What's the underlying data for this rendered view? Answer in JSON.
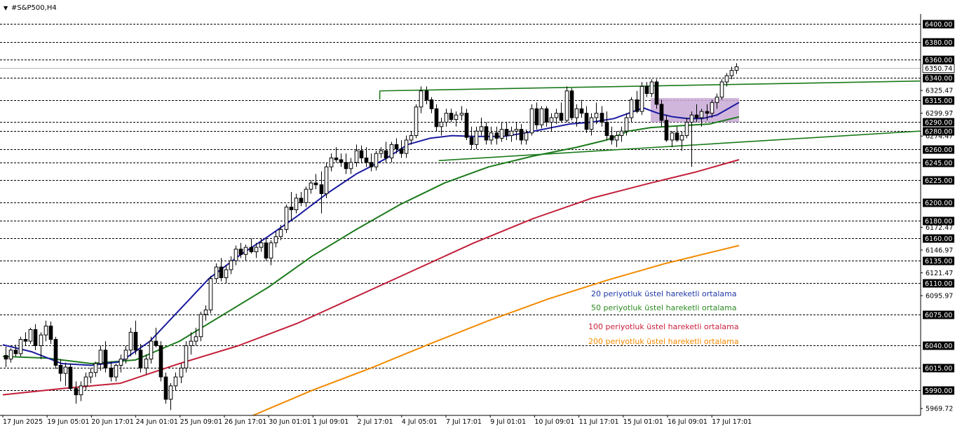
{
  "window": {
    "title": "#S&P500,H4",
    "menu_icon": "triangle-down-icon"
  },
  "chart_data": {
    "type": "candlestick",
    "symbol": "#S&P500",
    "timeframe": "H4",
    "ylim": [
      5962,
      6411
    ],
    "grid": "horizontal dashed at price levels",
    "price_levels": [
      6400.0,
      6380.0,
      6360.0,
      6340.0,
      6315.0,
      6290.0,
      6280.0,
      6260.0,
      6245.0,
      6225.0,
      6200.0,
      6180.0,
      6160.0,
      6135.0,
      6110.0,
      6075.0,
      6040.0,
      6015.0,
      5990.0
    ],
    "price_labels": [
      "6400.00",
      "6380.00",
      "6360.00",
      "6340.00",
      "6315.00",
      "6290.00",
      "6280.00",
      "6260.00",
      "6245.00",
      "6225.00",
      "6200.00",
      "6180.00",
      "6160.00",
      "6135.00",
      "6110.00",
      "6075.00",
      "6040.00",
      "6015.00",
      "5990.00"
    ],
    "y_tick_labels": [
      {
        "value": 6325.47,
        "label": "6325.47"
      },
      {
        "value": 6299.97,
        "label": "6299.97"
      },
      {
        "value": 6274.47,
        "label": "6274.47"
      },
      {
        "value": 6172.47,
        "label": "6172.47"
      },
      {
        "value": 6146.97,
        "label": "6146.97"
      },
      {
        "value": 6121.47,
        "label": "6121.47"
      },
      {
        "value": 6095.97,
        "label": "6095.97"
      },
      {
        "value": 5969.72,
        "label": "5969.72"
      }
    ],
    "current_price": {
      "value": 6350.74,
      "label": "6350.74"
    },
    "x_labels": [
      "17 Jun 2025",
      "19 Jun 05:01",
      "20 Jun 17:01",
      "24 Jun 01:01",
      "25 Jun 09:01",
      "26 Jun 17:01",
      "30 Jun 01:01",
      "1 Jul 09:01",
      "2 Jul 17:01",
      "4 Jul 05:01",
      "7 Jul 17:01",
      "9 Jul 01:01",
      "10 Jul 09:01",
      "11 Jul 17:01",
      "15 Jul 01:01",
      "16 Jul 09:01",
      "17 Jul 17:01"
    ],
    "candles": [
      [
        6029,
        6039,
        6016,
        6025
      ],
      [
        6025,
        6037,
        6021,
        6035
      ],
      [
        6035,
        6041,
        6028,
        6031
      ],
      [
        6031,
        6050,
        6028,
        6047
      ],
      [
        6047,
        6055,
        6040,
        6045
      ],
      [
        6045,
        6060,
        6042,
        6058
      ],
      [
        6058,
        6064,
        6035,
        6040
      ],
      [
        6040,
        6055,
        6025,
        6052
      ],
      [
        6052,
        6068,
        6045,
        6062
      ],
      [
        6062,
        6067,
        6042,
        6047
      ],
      [
        6047,
        6050,
        6014,
        6018
      ],
      [
        6018,
        6025,
        6000,
        6009
      ],
      [
        6009,
        6021,
        5995,
        6016
      ],
      [
        6016,
        6020,
        5990,
        5992
      ],
      [
        5992,
        6000,
        5975,
        5985
      ],
      [
        5985,
        6000,
        5978,
        5995
      ],
      [
        5995,
        6010,
        5990,
        6005
      ],
      [
        6005,
        6015,
        5998,
        6010
      ],
      [
        6010,
        6022,
        6005,
        6020
      ],
      [
        6020,
        6040,
        6012,
        6035
      ],
      [
        6035,
        6045,
        6010,
        6015
      ],
      [
        6015,
        6022,
        6000,
        6005
      ],
      [
        6005,
        6020,
        6000,
        6018
      ],
      [
        6018,
        6030,
        6010,
        6025
      ],
      [
        6025,
        6040,
        6020,
        6035
      ],
      [
        6035,
        6060,
        6028,
        6055
      ],
      [
        6055,
        6068,
        6030,
        6035
      ],
      [
        6035,
        6042,
        6010,
        6015
      ],
      [
        6015,
        6030,
        6008,
        6025
      ],
      [
        6025,
        6050,
        6020,
        6045
      ],
      [
        6045,
        6060,
        6038,
        6040
      ],
      [
        6040,
        6045,
        6000,
        6005
      ],
      [
        6005,
        6010,
        5975,
        5980
      ],
      [
        5980,
        5998,
        5968,
        5995
      ],
      [
        5995,
        6010,
        5990,
        6005
      ],
      [
        6005,
        6020,
        5998,
        6015
      ],
      [
        6015,
        6045,
        6010,
        6040
      ],
      [
        6040,
        6055,
        6030,
        6045
      ],
      [
        6045,
        6060,
        6040,
        6050
      ],
      [
        6050,
        6078,
        6045,
        6075
      ],
      [
        6075,
        6085,
        6068,
        6080
      ],
      [
        6080,
        6118,
        6076,
        6115
      ],
      [
        6115,
        6132,
        6110,
        6128
      ],
      [
        6128,
        6138,
        6112,
        6116
      ],
      [
        6116,
        6130,
        6110,
        6125
      ],
      [
        6125,
        6140,
        6120,
        6135
      ],
      [
        6135,
        6152,
        6130,
        6148
      ],
      [
        6148,
        6155,
        6138,
        6142
      ],
      [
        6142,
        6153,
        6135,
        6150
      ],
      [
        6150,
        6160,
        6143,
        6145
      ],
      [
        6145,
        6155,
        6138,
        6150
      ],
      [
        6150,
        6160,
        6145,
        6155
      ],
      [
        6155,
        6160,
        6135,
        6138
      ],
      [
        6138,
        6158,
        6130,
        6155
      ],
      [
        6155,
        6168,
        6150,
        6162
      ],
      [
        6162,
        6175,
        6158,
        6170
      ],
      [
        6170,
        6198,
        6166,
        6195
      ],
      [
        6195,
        6212,
        6180,
        6192
      ],
      [
        6192,
        6210,
        6188,
        6205
      ],
      [
        6205,
        6212,
        6196,
        6200
      ],
      [
        6200,
        6218,
        6195,
        6215
      ],
      [
        6215,
        6225,
        6210,
        6222
      ],
      [
        6222,
        6232,
        6215,
        6220
      ],
      [
        6220,
        6235,
        6188,
        6210
      ],
      [
        6210,
        6245,
        6205,
        6240
      ],
      [
        6240,
        6255,
        6235,
        6250
      ],
      [
        6250,
        6262,
        6245,
        6248
      ],
      [
        6248,
        6255,
        6240,
        6245
      ],
      [
        6245,
        6255,
        6232,
        6238
      ],
      [
        6238,
        6250,
        6232,
        6245
      ],
      [
        6245,
        6265,
        6240,
        6258
      ],
      [
        6258,
        6264,
        6245,
        6250
      ],
      [
        6250,
        6262,
        6240,
        6245
      ],
      [
        6245,
        6255,
        6235,
        6240
      ],
      [
        6240,
        6258,
        6236,
        6255
      ],
      [
        6255,
        6262,
        6250,
        6258
      ],
      [
        6258,
        6268,
        6245,
        6250
      ],
      [
        6250,
        6268,
        6245,
        6265
      ],
      [
        6265,
        6272,
        6255,
        6260
      ],
      [
        6260,
        6270,
        6250,
        6255
      ],
      [
        6255,
        6275,
        6250,
        6270
      ],
      [
        6270,
        6280,
        6265,
        6275
      ],
      [
        6275,
        6310,
        6272,
        6307
      ],
      [
        6307,
        6330,
        6300,
        6325
      ],
      [
        6325,
        6330,
        6310,
        6315
      ],
      [
        6315,
        6318,
        6300,
        6305
      ],
      [
        6305,
        6310,
        6280,
        6285
      ],
      [
        6285,
        6295,
        6275,
        6290
      ],
      [
        6290,
        6305,
        6285,
        6300
      ],
      [
        6300,
        6305,
        6290,
        6293
      ],
      [
        6293,
        6302,
        6285,
        6298
      ],
      [
        6298,
        6308,
        6292,
        6300
      ],
      [
        6300,
        6305,
        6270,
        6273
      ],
      [
        6273,
        6285,
        6260,
        6265
      ],
      [
        6265,
        6285,
        6260,
        6280
      ],
      [
        6280,
        6295,
        6275,
        6285
      ],
      [
        6285,
        6290,
        6265,
        6270
      ],
      [
        6270,
        6285,
        6265,
        6278
      ],
      [
        6278,
        6285,
        6265,
        6272
      ],
      [
        6272,
        6290,
        6268,
        6282
      ],
      [
        6282,
        6290,
        6270,
        6275
      ],
      [
        6275,
        6285,
        6268,
        6280
      ],
      [
        6280,
        6290,
        6270,
        6282
      ],
      [
        6282,
        6288,
        6265,
        6270
      ],
      [
        6270,
        6282,
        6265,
        6278
      ],
      [
        6278,
        6310,
        6275,
        6305
      ],
      [
        6305,
        6312,
        6282,
        6287
      ],
      [
        6287,
        6308,
        6283,
        6305
      ],
      [
        6305,
        6308,
        6285,
        6290
      ],
      [
        6290,
        6300,
        6280,
        6295
      ],
      [
        6295,
        6305,
        6288,
        6300
      ],
      [
        6300,
        6312,
        6290,
        6292
      ],
      [
        6292,
        6330,
        6290,
        6325
      ],
      [
        6325,
        6328,
        6292,
        6295
      ],
      [
        6295,
        6310,
        6285,
        6305
      ],
      [
        6305,
        6315,
        6295,
        6300
      ],
      [
        6300,
        6308,
        6278,
        6282
      ],
      [
        6282,
        6300,
        6275,
        6295
      ],
      [
        6295,
        6312,
        6288,
        6300
      ],
      [
        6300,
        6308,
        6285,
        6290
      ],
      [
        6290,
        6302,
        6270,
        6275
      ],
      [
        6275,
        6285,
        6265,
        6270
      ],
      [
        6270,
        6280,
        6262,
        6275
      ],
      [
        6275,
        6285,
        6268,
        6280
      ],
      [
        6280,
        6300,
        6275,
        6295
      ],
      [
        6295,
        6318,
        6290,
        6315
      ],
      [
        6315,
        6325,
        6300,
        6302
      ],
      [
        6302,
        6335,
        6298,
        6330
      ],
      [
        6330,
        6335,
        6318,
        6322
      ],
      [
        6322,
        6338,
        6318,
        6335
      ],
      [
        6335,
        6338,
        6305,
        6310
      ],
      [
        6310,
        6315,
        6285,
        6292
      ],
      [
        6292,
        6298,
        6268,
        6270
      ],
      [
        6270,
        6280,
        6262,
        6278
      ],
      [
        6278,
        6285,
        6268,
        6270
      ],
      [
        6270,
        6280,
        6258,
        6275
      ],
      [
        6275,
        6295,
        6272,
        6290
      ],
      [
        6290,
        6302,
        6240,
        6298
      ],
      [
        6298,
        6310,
        6290,
        6295
      ],
      [
        6295,
        6305,
        6285,
        6302
      ],
      [
        6302,
        6310,
        6292,
        6300
      ],
      [
        6300,
        6315,
        6295,
        6312
      ],
      [
        6312,
        6322,
        6305,
        6318
      ],
      [
        6318,
        6338,
        6315,
        6335
      ],
      [
        6335,
        6345,
        6330,
        6342
      ],
      [
        6342,
        6352,
        6338,
        6348
      ],
      [
        6348,
        6356,
        6344,
        6352
      ]
    ],
    "ema20": [
      [
        0,
        6041
      ],
      [
        20,
        6033
      ],
      [
        40,
        6020
      ],
      [
        60,
        6018
      ],
      [
        80,
        6022
      ],
      [
        100,
        6045
      ],
      [
        120,
        6080
      ],
      [
        140,
        6115
      ],
      [
        160,
        6140
      ],
      [
        180,
        6162
      ],
      [
        200,
        6185
      ],
      [
        220,
        6210
      ],
      [
        240,
        6232
      ],
      [
        260,
        6249
      ],
      [
        275,
        6265
      ],
      [
        290,
        6272
      ],
      [
        305,
        6275
      ],
      [
        320,
        6274
      ],
      [
        340,
        6274
      ],
      [
        355,
        6278
      ],
      [
        370,
        6283
      ],
      [
        385,
        6288
      ],
      [
        400,
        6290
      ],
      [
        415,
        6294
      ],
      [
        425,
        6300
      ],
      [
        435,
        6306
      ],
      [
        445,
        6300
      ],
      [
        455,
        6296
      ],
      [
        465,
        6294
      ],
      [
        475,
        6294
      ],
      [
        485,
        6298
      ],
      [
        500,
        6312
      ]
    ],
    "ema50": [
      [
        0,
        6028
      ],
      [
        30,
        6026
      ],
      [
        60,
        6020
      ],
      [
        90,
        6024
      ],
      [
        120,
        6045
      ],
      [
        150,
        6075
      ],
      [
        180,
        6105
      ],
      [
        210,
        6140
      ],
      [
        240,
        6170
      ],
      [
        270,
        6198
      ],
      [
        300,
        6222
      ],
      [
        330,
        6240
      ],
      [
        360,
        6252
      ],
      [
        390,
        6262
      ],
      [
        410,
        6270
      ],
      [
        425,
        6280
      ],
      [
        440,
        6284
      ],
      [
        460,
        6286
      ],
      [
        480,
        6288
      ],
      [
        500,
        6296
      ]
    ],
    "ema100": [
      [
        0,
        5985
      ],
      [
        40,
        5992
      ],
      [
        80,
        5998
      ],
      [
        120,
        6020
      ],
      [
        160,
        6040
      ],
      [
        200,
        6065
      ],
      [
        240,
        6095
      ],
      [
        280,
        6125
      ],
      [
        320,
        6155
      ],
      [
        360,
        6182
      ],
      [
        400,
        6205
      ],
      [
        440,
        6222
      ],
      [
        470,
        6234
      ],
      [
        500,
        6248
      ]
    ],
    "ema200": [
      [
        170,
        5962
      ],
      [
        210,
        5990
      ],
      [
        250,
        6015
      ],
      [
        290,
        6042
      ],
      [
        330,
        6068
      ],
      [
        370,
        6092
      ],
      [
        410,
        6113
      ],
      [
        450,
        6132
      ],
      [
        500,
        6152
      ]
    ],
    "trendlines": [
      {
        "name": "upper-resistance",
        "color": "#1a7a1a",
        "points": [
          [
            256,
            6325
          ],
          [
            1312,
            6336
          ]
        ],
        "anchor": [
          [
            256,
            6325
          ],
          [
            256,
            6320
          ]
        ]
      },
      {
        "name": "rising-support",
        "color": "#1a7a1a",
        "points": [
          [
            296,
            6247
          ],
          [
            1312,
            6280
          ]
        ]
      }
    ],
    "highlight_box": {
      "color": "#c9a9d6",
      "x0": 440,
      "x1": 500,
      "y0": 6290,
      "y1": 6317
    },
    "legend": [
      {
        "label": "20 periyotluk üstel hareketli ortalama",
        "color": "#1f3aa8"
      },
      {
        "label": "50 periyotluk üstel hareketli ortalama",
        "color": "#2e8b22"
      },
      {
        "label": "100 periyotluk üstel hareketli ortalama",
        "color": "#cc1f3c"
      },
      {
        "label": "200 periyotluk üstel hareketli ortalama",
        "color": "#f28a00"
      }
    ],
    "colors": {
      "ema20": "#1a1aa0",
      "ema50": "#1b7a1b",
      "ema100": "#c21f3a",
      "ema200": "#f28a00",
      "candle": "#000000",
      "grid": "#000000",
      "current_line": "#b8b8b8",
      "highlight": "#c9a9d6"
    }
  }
}
